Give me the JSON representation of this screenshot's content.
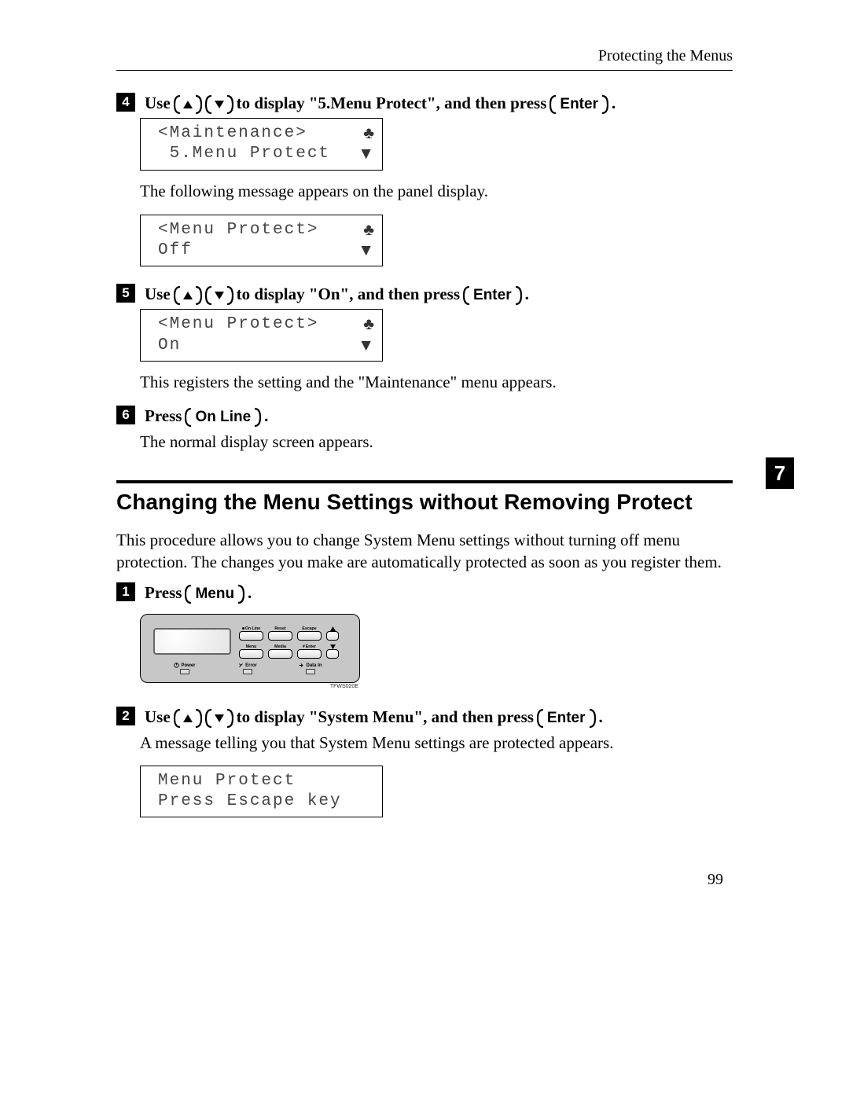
{
  "header": "Protecting the Menus",
  "chapter": "7",
  "pageNumber": "99",
  "section1": {
    "step4": {
      "use": "Use",
      "mid": "to display \"5.Menu Protect\", and then press",
      "enter": "Enter",
      "period": "."
    },
    "lcd1": {
      "r1a": "<Maintenance>",
      "r2a": " 5.Menu Protect"
    },
    "msg1": "The following message appears on the panel display.",
    "lcd2": {
      "r1a": "<Menu Protect>",
      "r2a": "Off"
    },
    "step5": {
      "use": "Use",
      "mid": "to display \"On\", and then press",
      "enter": "Enter",
      "period": "."
    },
    "lcd3": {
      "r1a": "<Menu Protect>",
      "r2a": "On"
    },
    "msg2": "This registers the setting and the \"Maintenance\" menu appears.",
    "step6": {
      "press": "Press",
      "key": "On Line",
      "period": "."
    },
    "msg3": "The normal display screen appears."
  },
  "sectHeading": "Changing the Menu Settings without Removing Protect",
  "intro": "This procedure allows you to change System Menu settings without turning off menu protection. The changes you make are automatically protected as soon as you register them.",
  "section2": {
    "step1": {
      "press": "Press",
      "key": "Menu",
      "period": "."
    },
    "panel": {
      "row1": [
        "On Line",
        "Reset",
        "Escape"
      ],
      "row2": [
        "Menu",
        "Media",
        "Enter"
      ],
      "leds": [
        "Power",
        "Error",
        "Data In"
      ],
      "code": "TFWS020E"
    },
    "step2": {
      "use": "Use",
      "mid": "to display \"System Menu\", and then press",
      "enter": "Enter",
      "period": "."
    },
    "msg4": "A message telling you that System Menu settings are protected appears.",
    "lcd4": {
      "r1a": "Menu Protect",
      "r2a": "Press Escape key"
    }
  }
}
